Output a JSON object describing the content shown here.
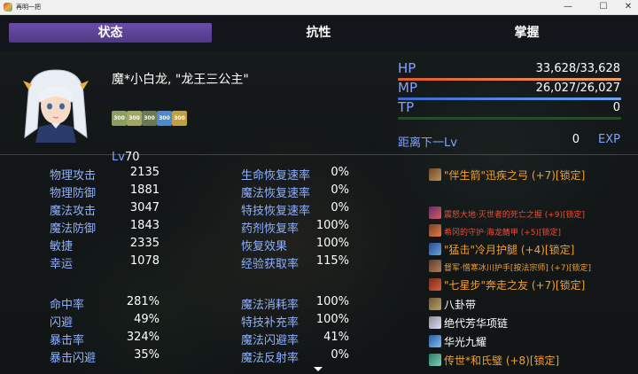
{
  "window": {
    "title": "再明一把",
    "minimize": "—",
    "maximize": "☐",
    "close": "✕"
  },
  "tabs": [
    {
      "label": "状态",
      "active": true
    },
    {
      "label": "抗性",
      "active": false
    },
    {
      "label": "掌握",
      "active": false
    }
  ],
  "actor": {
    "name": "魔*小白龙, \"龙王三公主\"",
    "level_label": "Lv",
    "level": "70",
    "hp_label": "HP",
    "hp_value": "33,628/33,628",
    "mp_label": "MP",
    "mp_value": "26,027/26,027",
    "tp_label": "TP",
    "tp_value": "0",
    "next_label": "距离下一Lv",
    "next_value": "0",
    "exp_unit": "EXP",
    "states": [
      "300",
      "300",
      "300",
      "300",
      "300"
    ]
  },
  "params_left": [
    {
      "label": "物理攻击",
      "value": "2135"
    },
    {
      "label": "物理防御",
      "value": "1881"
    },
    {
      "label": "魔法攻击",
      "value": "3047"
    },
    {
      "label": "魔法防御",
      "value": "1843"
    },
    {
      "label": "敏捷",
      "value": "2335"
    },
    {
      "label": "幸运",
      "value": "1078"
    }
  ],
  "params_mid": [
    {
      "label": "生命恢复速率",
      "value": "0%"
    },
    {
      "label": "魔法恢复速率",
      "value": "0%"
    },
    {
      "label": "特技恢复速率",
      "value": "0%"
    },
    {
      "label": "药剂恢复率",
      "value": "100%"
    },
    {
      "label": "恢复效果",
      "value": "100%"
    },
    {
      "label": "经验获取率",
      "value": "115%"
    }
  ],
  "params_left2": [
    {
      "label": "命中率",
      "value": "281%"
    },
    {
      "label": "闪避",
      "value": "49%"
    },
    {
      "label": "暴击率",
      "value": "324%"
    },
    {
      "label": "暴击闪避",
      "value": "35%"
    }
  ],
  "params_mid2": [
    {
      "label": "魔法消耗率",
      "value": "100%"
    },
    {
      "label": "特技补充率",
      "value": "100%"
    },
    {
      "label": "魔法闪避率",
      "value": "41%"
    },
    {
      "label": "魔法反射率",
      "value": "0%"
    }
  ],
  "equipment": [
    {
      "name": "\"伴生箭\"迅疾之弓 (+7)[锁定]",
      "color": "#f0a030",
      "icon": "bow-icon"
    },
    {
      "name": "震怒大地·灭世者的死亡之握 (+9)[锁定]",
      "color": "#e8503a",
      "icon": "gauntlet-icon"
    },
    {
      "name": "希冈的守护·海龙鳍甲 (+5)[锁定]",
      "color": "#e8503a",
      "icon": "armor-icon"
    },
    {
      "name": "\"猛击\"冷月护腿 (+4)[锁定]",
      "color": "#f0a030",
      "icon": "leggings-icon"
    },
    {
      "name": "督军·憎寒冰川护手[按法宗师] (+7)[锁定]",
      "color": "#f0a030",
      "icon": "gloves-icon"
    },
    {
      "name": "\"七星步\"奔走之友 (+7)[锁定]",
      "color": "#f0a030",
      "icon": "boots-icon"
    },
    {
      "name": "八卦带",
      "color": "#ffffff",
      "icon": "belt-icon"
    },
    {
      "name": "绝代芳华项链",
      "color": "#ffffff",
      "icon": "necklace-icon"
    },
    {
      "name": "华光九耀",
      "color": "#ffffff",
      "icon": "ring-icon"
    },
    {
      "name": "传世*和氏璧 (+8)[锁定]",
      "color": "#f0a030",
      "icon": "jade-icon"
    }
  ],
  "colors": {
    "accent_tab": "#5a43a0",
    "system_label": "#7fa3ff",
    "hp_gauge": "#e07840",
    "mp_gauge": "#4a8ae8",
    "tp_gauge": "#3a7a3a"
  }
}
